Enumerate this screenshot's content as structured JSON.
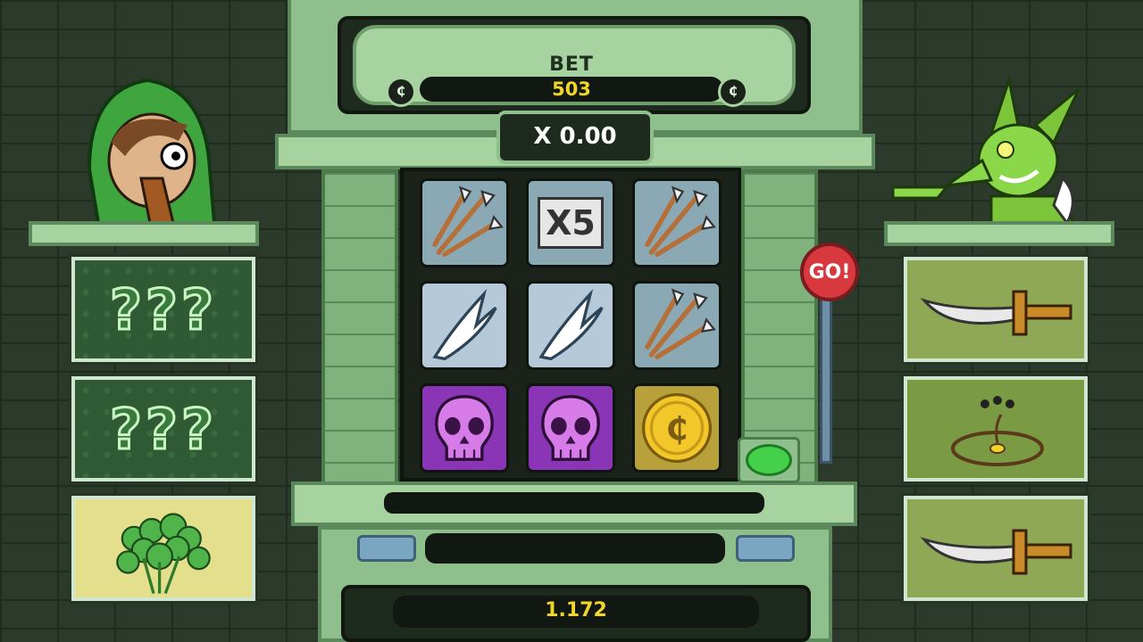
{
  "bet": {
    "label": "BET",
    "value": "503",
    "decrease_icon": "coin-left-icon",
    "increase_icon": "coin-right-icon",
    "left_symbol": "₵",
    "right_symbol": "₵"
  },
  "multiplier": {
    "text": "X 0.00"
  },
  "reels": [
    [
      "arrows",
      "x5",
      "arrows"
    ],
    [
      "claw",
      "claw",
      "arrows"
    ],
    [
      "skull",
      "skull",
      "coin"
    ]
  ],
  "x5_label": "X5",
  "win": {
    "value": "1.172"
  },
  "go_button": {
    "label": "GO!"
  },
  "left_panel": {
    "character": "hooded-archer",
    "cards": [
      {
        "type": "mystery",
        "text": "???"
      },
      {
        "type": "mystery",
        "text": "???"
      },
      {
        "type": "clover",
        "icon": "four-leaf-clover-icon"
      }
    ]
  },
  "right_panel": {
    "character": "goblin",
    "cards": [
      {
        "type": "weapon",
        "icon": "dagger-icon"
      },
      {
        "type": "curse",
        "icon": "trap-icon"
      },
      {
        "type": "weapon",
        "icon": "dagger-icon"
      }
    ]
  },
  "colors": {
    "accent_yellow": "#f2d52a",
    "machine_green": "#8fbf8c",
    "skull_purple": "#8a35b5",
    "go_red": "#d8393f"
  }
}
